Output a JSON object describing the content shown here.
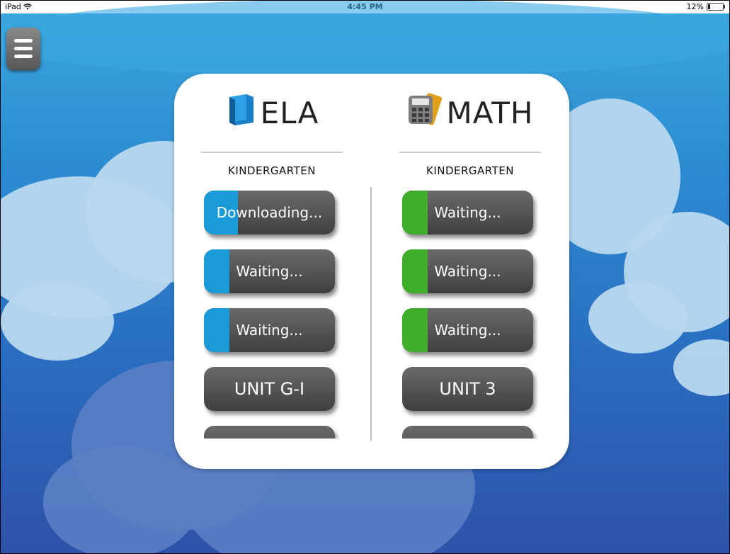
{
  "status_bar": {
    "device": "iPad",
    "wifi_icon": "wifi-icon",
    "time": "4:45 PM",
    "battery": "12%",
    "battery_level": 0.12
  },
  "menu": {
    "icon": "hamburger-icon"
  },
  "colors": {
    "ela_progress": "#1a9ad6",
    "math_progress": "#3fae2a",
    "panel": "#ffffff"
  },
  "ela": {
    "title": "ELA",
    "icon": "book-icon",
    "grade": "KINDERGARTEN",
    "buttons": [
      {
        "label": "Downloading...",
        "state": "downloading"
      },
      {
        "label": "Waiting...",
        "state": "waiting"
      },
      {
        "label": "Waiting...",
        "state": "waiting"
      },
      {
        "label": "UNIT G-I",
        "state": "unit"
      },
      {
        "label": "",
        "state": "unit"
      }
    ]
  },
  "math": {
    "title": "MATH",
    "icon": "calculator-icon",
    "grade": "KINDERGARTEN",
    "buttons": [
      {
        "label": "Waiting...",
        "state": "waiting"
      },
      {
        "label": "Waiting...",
        "state": "waiting"
      },
      {
        "label": "Waiting...",
        "state": "waiting"
      },
      {
        "label": "UNIT 3",
        "state": "unit"
      },
      {
        "label": "",
        "state": "unit"
      }
    ]
  }
}
